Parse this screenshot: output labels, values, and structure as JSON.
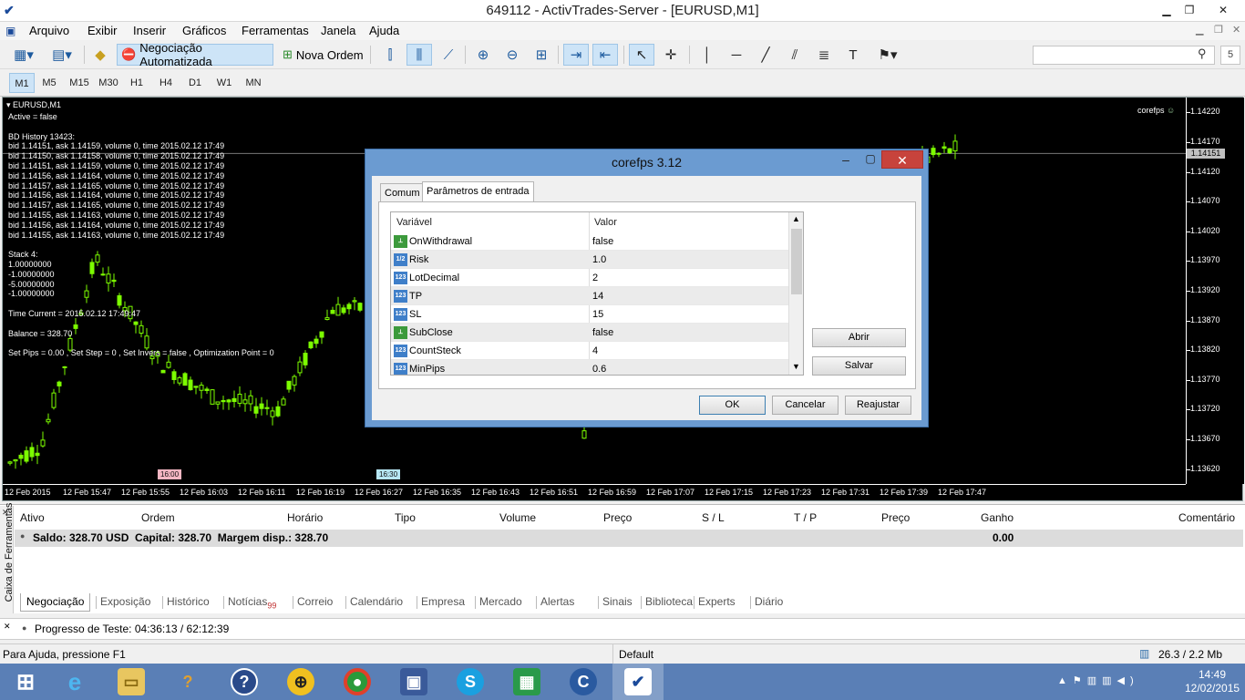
{
  "window": {
    "title": "649112 - ActivTrades-Server - [EURUSD,M1]"
  },
  "menu": [
    "Arquivo",
    "Exibir",
    "Inserir",
    "Gráficos",
    "Ferramentas",
    "Janela",
    "Ajuda"
  ],
  "toolbar": {
    "auto_trading": "Negociação Automatizada",
    "new_order": "Nova Ordem",
    "notif_count": "5"
  },
  "timeframes": [
    "M1",
    "M5",
    "M15",
    "M30",
    "H1",
    "H4",
    "D1",
    "W1",
    "MN"
  ],
  "chart": {
    "name": "EURUSD,M1",
    "ea_tag": "corefps",
    "current_price": "1.14151",
    "info_lines": [
      "Active = false",
      "",
      "BD History 13423:",
      "bid 1.14151, ask 1.14159, volume 0, time 2015.02.12 17:49",
      "bid 1.14150, ask 1.14158, volume 0, time 2015.02.12 17:49",
      "bid 1.14151, ask 1.14159, volume 0, time 2015.02.12 17:49",
      "bid 1.14156, ask 1.14164, volume 0, time 2015.02.12 17:49",
      "bid 1.14157, ask 1.14165, volume 0, time 2015.02.12 17:49",
      "bid 1.14156, ask 1.14164, volume 0, time 2015.02.12 17:49",
      "bid 1.14157, ask 1.14165, volume 0, time 2015.02.12 17:49",
      "bid 1.14155, ask 1.14163, volume 0, time 2015.02.12 17:49",
      "bid 1.14156, ask 1.14164, volume 0, time 2015.02.12 17:49",
      "bid 1.14155, ask 1.14163, volume 0, time 2015.02.12 17:49",
      "",
      "Stack 4:",
      "1.00000000",
      "-1.00000000",
      "-5.00000000",
      "-1.00000000",
      "",
      "Time Current = 2015.02.12 17:49:47",
      "",
      "Balance = 328.70",
      "",
      "Set Pips = 0.00 , Set Step = 0 , Set Invers = false , Optimization Point = 0"
    ],
    "vmarkers": [
      "16:00",
      "16:30"
    ]
  },
  "chart_data": {
    "type": "candlestick",
    "ylim": [
      1.13595,
      1.14245
    ],
    "price_ticks": [
      "1.14220",
      "1.14170",
      "1.14120",
      "1.14070",
      "1.14020",
      "1.13970",
      "1.13920",
      "1.13870",
      "1.13820",
      "1.13770",
      "1.13720",
      "1.13670",
      "1.13620"
    ],
    "time_ticks": [
      "12 Feb 2015",
      "12 Feb 15:47",
      "12 Feb 15:55",
      "12 Feb 16:03",
      "12 Feb 16:11",
      "12 Feb 16:19",
      "12 Feb 16:27",
      "12 Feb 16:35",
      "12 Feb 16:43",
      "12 Feb 16:51",
      "12 Feb 16:59",
      "12 Feb 17:07",
      "12 Feb 17:15",
      "12 Feb 17:23",
      "12 Feb 17:31",
      "12 Feb 17:39",
      "12 Feb 17:47"
    ]
  },
  "dialog": {
    "title": "corefps 3.12",
    "tabs": [
      "Comum",
      "Parâmetros de entrada"
    ],
    "col_var": "Variável",
    "col_val": "Valor",
    "params": [
      {
        "type": "bool",
        "name": "OnWithdrawal",
        "value": "false"
      },
      {
        "type": "num",
        "name": "Risk",
        "value": "1.0"
      },
      {
        "type": "num",
        "name": "LotDecimal",
        "value": "2"
      },
      {
        "type": "num",
        "name": "TP",
        "value": "14"
      },
      {
        "type": "num",
        "name": "SL",
        "value": "15"
      },
      {
        "type": "bool",
        "name": "SubClose",
        "value": "false"
      },
      {
        "type": "num",
        "name": "CountSteck",
        "value": "4"
      },
      {
        "type": "num",
        "name": "MinPips",
        "value": "0.6"
      }
    ],
    "icon_num": "1/2",
    "icon_num2": "123",
    "btn_open": "Abrir",
    "btn_save": "Salvar",
    "btn_ok": "OK",
    "btn_cancel": "Cancelar",
    "btn_reset": "Reajustar"
  },
  "terminal": {
    "side_label": "Caixa de Ferramentas",
    "headers": [
      "Ativo",
      "Ordem",
      "Horário",
      "Tipo",
      "Volume",
      "Preço",
      "S / L",
      "T / P",
      "Preço",
      "Ganho",
      "Comentário"
    ],
    "balance": "Saldo: 328.70 USD  Capital: 328.70  Margem disp.: 328.70",
    "profit": "0.00",
    "tabs": [
      "Negociação",
      "Exposição",
      "Histórico",
      "Notícias",
      "Correio",
      "Calendário",
      "Empresa",
      "Mercado",
      "Alertas",
      "Sinais",
      "Biblioteca",
      "Experts",
      "Diário"
    ],
    "news_badge": "99"
  },
  "progress": {
    "text": "Progresso de Teste: 04:36:13 / 62:12:39"
  },
  "status": {
    "help": "Para Ajuda, pressione F1",
    "profile": "Default",
    "traffic": "26.3 / 2.2 Mb"
  },
  "taskbar": {
    "time": "14:49",
    "date": "12/02/2015"
  },
  "colors": {
    "candle": "#7cfc00",
    "chart_bg": "#000000",
    "taskbar": "#5a7fb6",
    "close": "#c7433c"
  }
}
